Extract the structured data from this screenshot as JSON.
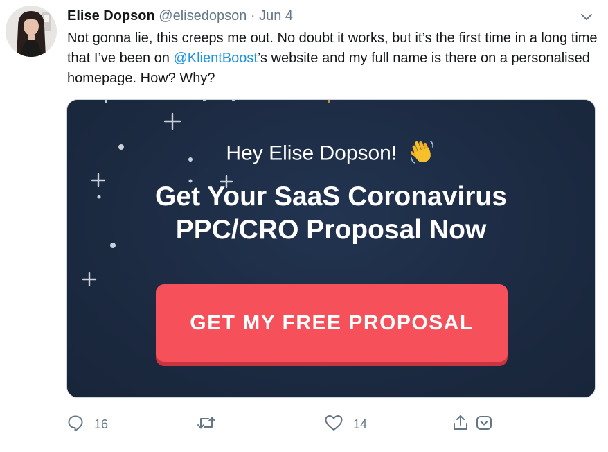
{
  "tweet": {
    "author": {
      "display_name": "Elise Dopson",
      "handle": "@elisedopson"
    },
    "separator": "·",
    "date": "Jun 4",
    "text": {
      "before_mention": "Not gonna lie, this creeps me out. No doubt it works, but it’s the first time in a long time that I’ve been on ",
      "mention": "@KlientBoost",
      "after_mention": "’s website and my full name is there on a personalised homepage. How? Why?"
    },
    "media": {
      "greeting": "Hey Elise Dopson!",
      "headline_line1": "Get Your SaaS Coronavirus",
      "headline_line2": "PPC/CRO Proposal Now",
      "cta_label": "GET MY FREE PROPOSAL",
      "colors": {
        "background": "#1e2e45",
        "cta": "#f6505b",
        "cta_shadow": "#c9343f",
        "text": "#ffffff"
      }
    },
    "actions": {
      "reply_count": "16",
      "retweet_count": "",
      "like_count": "14"
    },
    "icons": {
      "caret": "chevron-down-icon",
      "reply": "reply-icon",
      "retweet": "retweet-icon",
      "like": "heart-icon",
      "share": "share-icon",
      "analytics": "analytics-icon",
      "wave": "waving-hand-icon"
    },
    "colors": {
      "link": "#1b95e0",
      "secondary_text": "#657786",
      "primary_text": "#14171a"
    }
  }
}
